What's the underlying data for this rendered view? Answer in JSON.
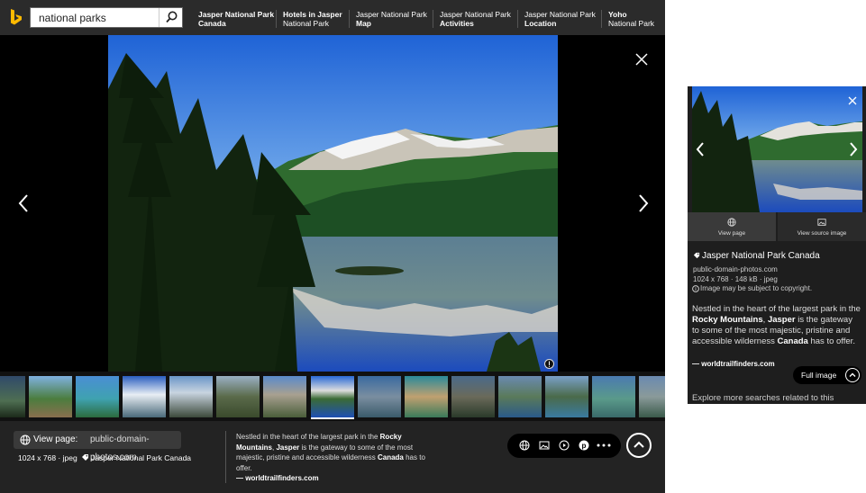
{
  "search": {
    "query": "national parks"
  },
  "related": [
    {
      "line1": "Jasper National Park",
      "line2": "Canada"
    },
    {
      "line1": "Hotels in Jasper",
      "line2": "National Park"
    },
    {
      "line1": "Jasper National Park",
      "line2": "Map"
    },
    {
      "line1": "Jasper National Park",
      "line2": "Activities"
    },
    {
      "line1": "Jasper National Park",
      "line2": "Location"
    },
    {
      "line1": "Yoho",
      "line2": "National Park"
    }
  ],
  "footer": {
    "view_page_label": "View page:",
    "view_page_domain": "public-domain-photos.com",
    "dimensions": "1024 x 768 · jpeg",
    "title": "Jasper National Park Canada",
    "desc": {
      "p1": "Nestled in the heart of the largest park in the ",
      "b1": "Rocky Mountains",
      "p2": ", ",
      "b2": "Jasper",
      "p3": " is the gateway to some of the most majestic, pristine and accessible wilderness ",
      "b3": "Canada",
      "p4": " has to offer."
    },
    "source": "— worldtrailfinders.com"
  },
  "panel": {
    "view_page": "View page",
    "view_source": "View source image",
    "title": "Jasper National Park Canada",
    "domain": "public-domain-photos.com",
    "size": "1024 x 768 · 148 kB · jpeg",
    "copyright": "Image may be subject to copyright.",
    "source": "— worldtrailfinders.com",
    "full_image": "Full image",
    "explore": "Explore more searches related to this"
  },
  "colors": {
    "bing_yellow": "#ffb900",
    "background_dark": "#000000"
  }
}
